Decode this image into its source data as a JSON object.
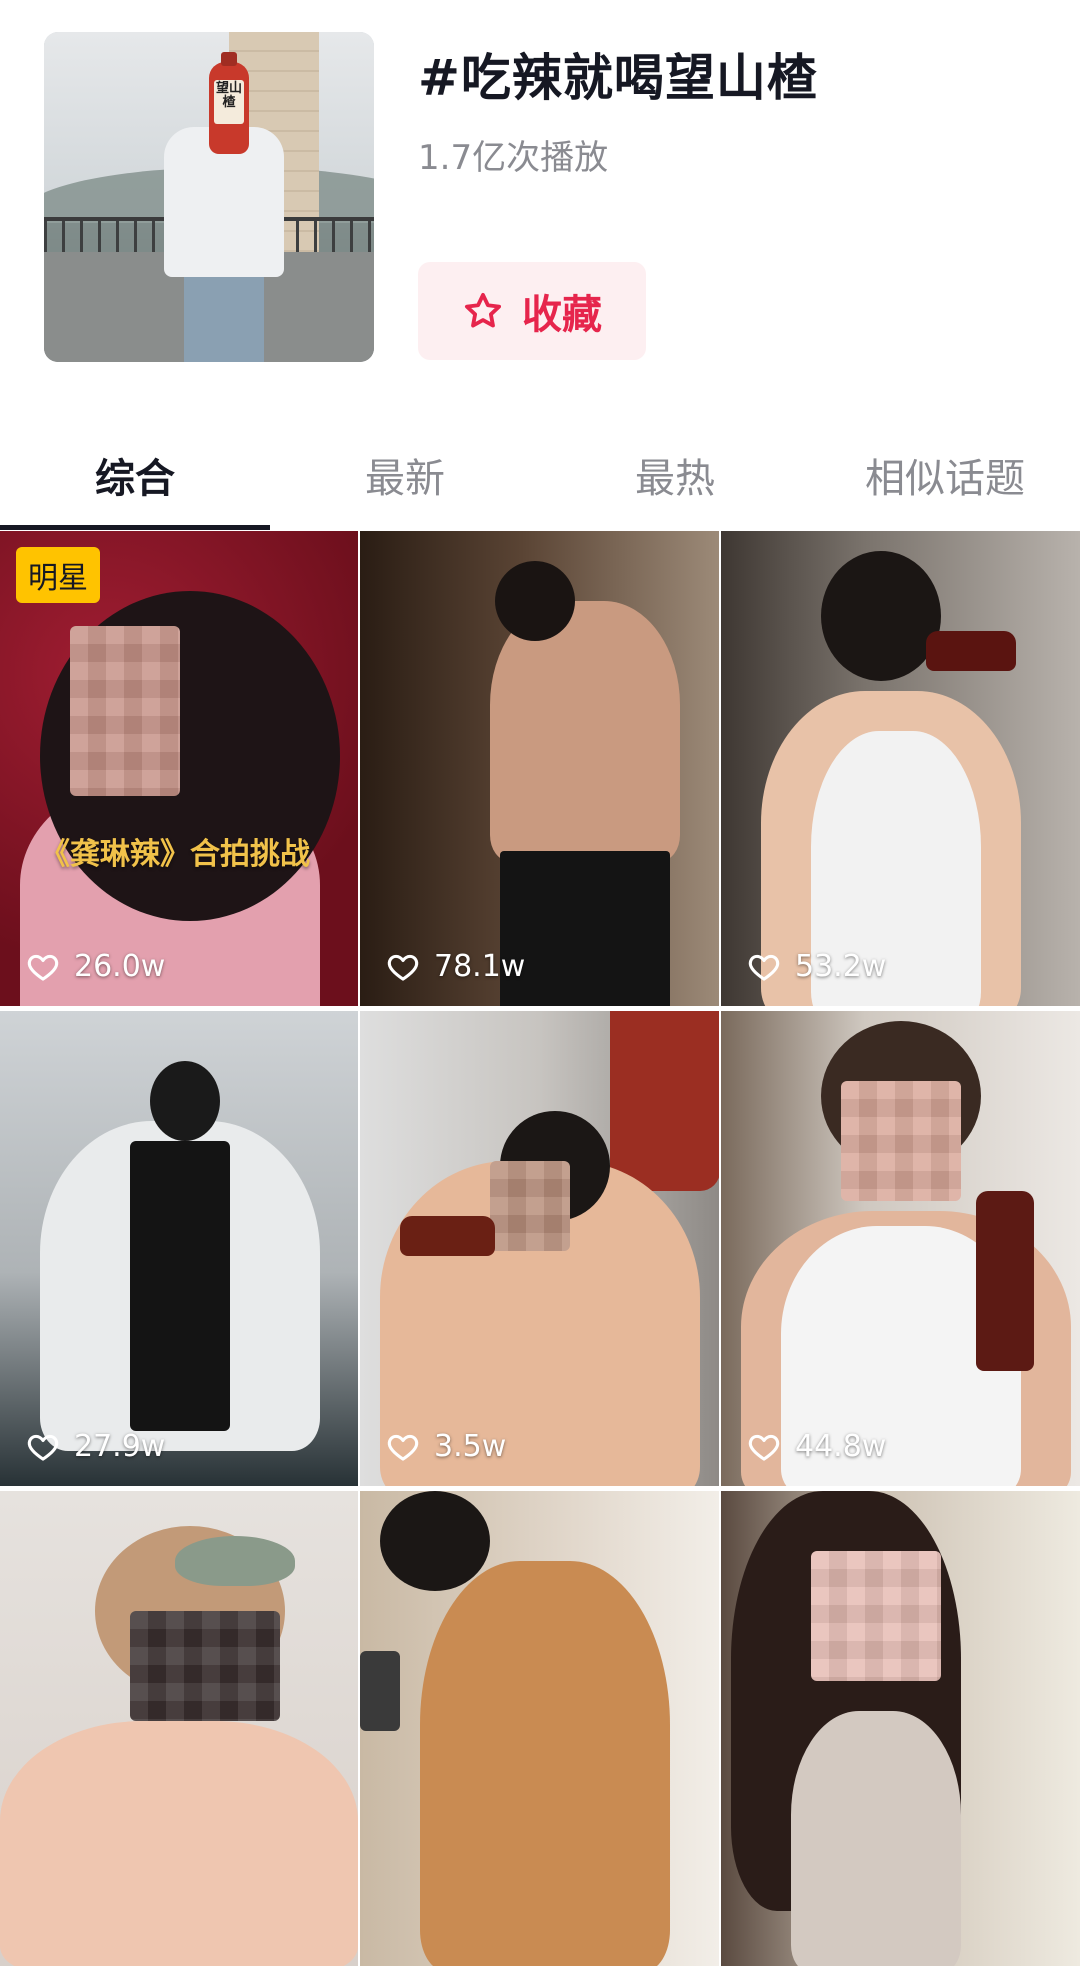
{
  "topic": {
    "title": "#吃辣就喝望山楂",
    "plays": "1.7亿次播放",
    "favorite_label": "收藏",
    "cover_bottle_text": "望山楂"
  },
  "tabs": [
    {
      "label": "综合",
      "active": true
    },
    {
      "label": "最新",
      "active": false
    },
    {
      "label": "最热",
      "active": false
    },
    {
      "label": "相似话题",
      "active": false
    }
  ],
  "videos": [
    {
      "likes": "26.0w",
      "badge": "明星",
      "caption": "《龚琳辣》合拍挑战"
    },
    {
      "likes": "78.1w"
    },
    {
      "likes": "53.2w"
    },
    {
      "likes": "27.9w"
    },
    {
      "likes": "3.5w"
    },
    {
      "likes": "44.8w"
    },
    {
      "likes": ""
    },
    {
      "likes": ""
    },
    {
      "likes": ""
    }
  ],
  "colors": {
    "accent": "#e6254c",
    "favorite_bg": "#fdeff1",
    "badge": "#ffc300",
    "text_primary": "#161823",
    "text_secondary": "#8a8b91"
  },
  "icons": {
    "favorite": "star-outline-icon",
    "likes": "heart-outline-icon"
  }
}
